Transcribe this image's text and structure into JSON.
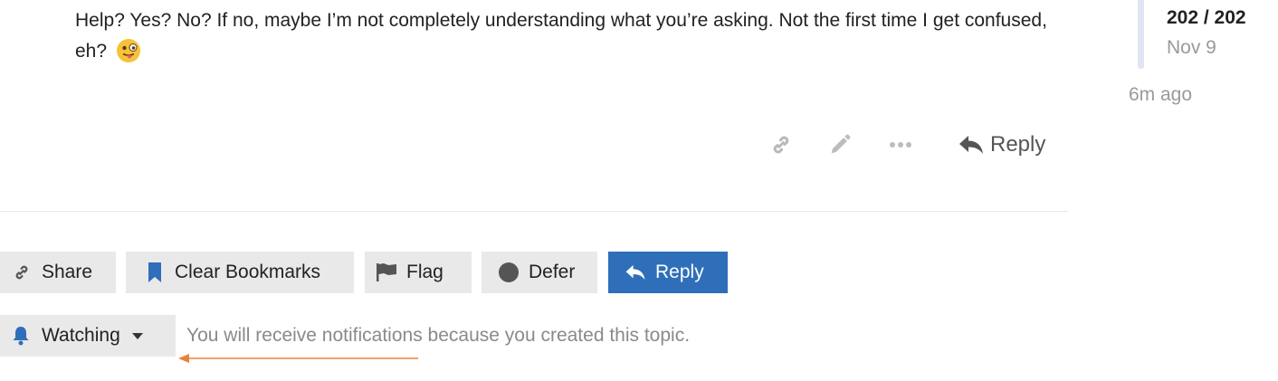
{
  "post": {
    "text": "Help? Yes? No? If no, maybe I’m not completely understanding what you’re asking. Not the first time I get confused, eh?",
    "emoji": "winking-face-with-tongue"
  },
  "timeline": {
    "count": "202 / 202",
    "date": "Nov 9",
    "ago": "6m ago"
  },
  "post_actions": {
    "reply_label": "Reply",
    "icons": [
      "link-icon",
      "pencil-icon",
      "ellipsis-icon",
      "reply-icon"
    ]
  },
  "footer_buttons": {
    "share": "Share",
    "clear_bookmarks": "Clear Bookmarks",
    "flag": "Flag",
    "defer": "Defer",
    "reply": "Reply"
  },
  "notifications": {
    "level": "Watching",
    "reason": "You will receive notifications because you created this topic."
  },
  "colors": {
    "primary": "#2f6fba",
    "button_bg": "#e9e9e9",
    "muted_text": "#8a8a8a",
    "timeline_bar": "#dfe6f2",
    "annotation_arrow": "#e8823a"
  }
}
